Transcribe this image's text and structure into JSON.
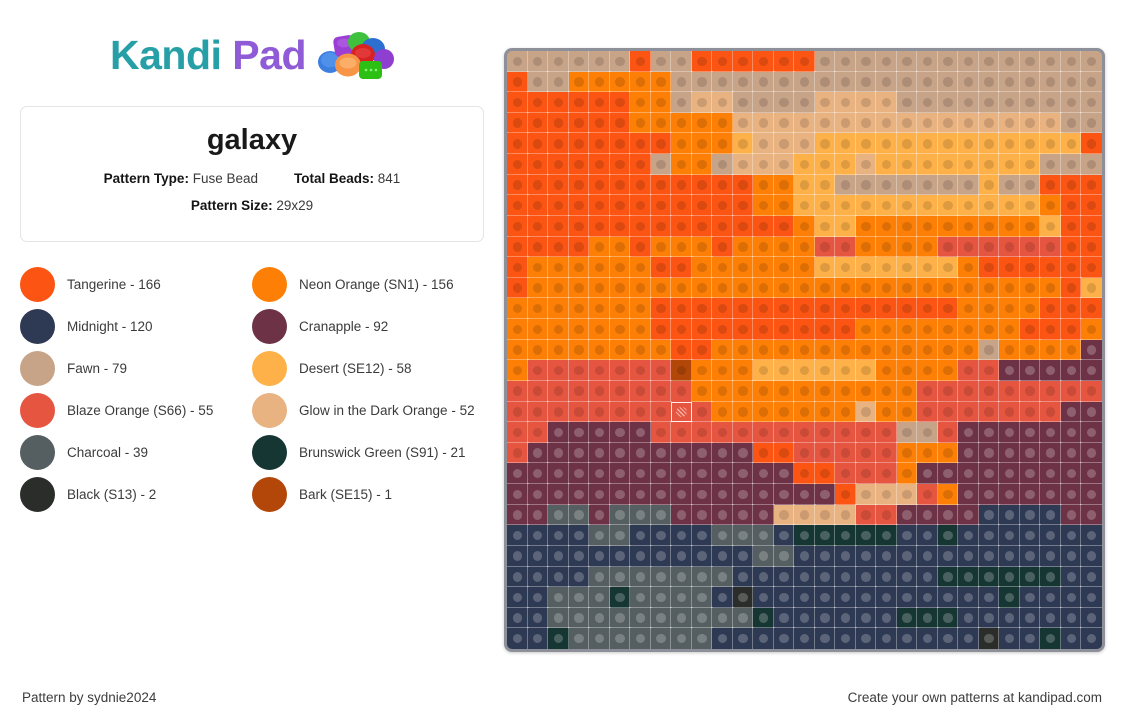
{
  "brand": {
    "name_part1": "Kandi",
    "name_part2": "Pad",
    "logo_icon": "kandi-beads-cluster-icon",
    "color_teal": "#26a0a6",
    "color_purple": "#8f5bd6"
  },
  "info": {
    "title": "galaxy",
    "pattern_type_label": "Pattern Type:",
    "pattern_type_value": "Fuse Bead",
    "total_beads_label": "Total Beads:",
    "total_beads_value": "841",
    "pattern_size_label": "Pattern Size:",
    "pattern_size_value": "29x29"
  },
  "legend": [
    {
      "name": "Tangerine",
      "count": 166,
      "label": "Tangerine - 166",
      "color": "#fb5413"
    },
    {
      "name": "Neon Orange (SN1)",
      "count": 156,
      "label": "Neon Orange (SN1) - 156",
      "color": "#fd7f06"
    },
    {
      "name": "Midnight",
      "count": 120,
      "label": "Midnight - 120",
      "color": "#2e3953"
    },
    {
      "name": "Cranapple",
      "count": 92,
      "label": "Cranapple - 92",
      "color": "#6e3247"
    },
    {
      "name": "Fawn",
      "count": 79,
      "label": "Fawn - 79",
      "color": "#c7a387"
    },
    {
      "name": "Desert (SE12)",
      "count": 58,
      "label": "Desert (SE12) - 58",
      "color": "#feb149"
    },
    {
      "name": "Blaze Orange (S66)",
      "count": 55,
      "label": "Blaze Orange (S66) - 55",
      "color": "#e65540"
    },
    {
      "name": "Glow in the Dark Orange",
      "count": 52,
      "label": "Glow in the Dark Orange - 52",
      "color": "#e9b281"
    },
    {
      "name": "Charcoal",
      "count": 39,
      "label": "Charcoal - 39",
      "color": "#555e60"
    },
    {
      "name": "Brunswick Green (S91)",
      "count": 21,
      "label": "Brunswick Green (S91) - 21",
      "color": "#163634"
    },
    {
      "name": "Black (S13)",
      "count": 2,
      "label": "Black (S13) - 2",
      "color": "#2b2d2b"
    },
    {
      "name": "Bark (SE15)",
      "count": 1,
      "label": "Bark (SE15) - 1",
      "color": "#b24709"
    }
  ],
  "pattern": {
    "width": 29,
    "height": 29,
    "selected_cell": {
      "row": 17,
      "col": 8
    },
    "palette": {
      "T": "#fb5413",
      "N": "#fd7f06",
      "M": "#2e3953",
      "C": "#6e3247",
      "F": "#c7a387",
      "D": "#feb149",
      "B": "#e65540",
      "G": "#e9b281",
      "H": "#555e60",
      "W": "#163634",
      "K": "#2b2d2b",
      "R": "#b24709"
    },
    "rows": [
      "FFFFFFTFFTTTTTTFFFFFFFFFFFFFF",
      "TFFNNNNNFFFFFFFFFFFFFFFFFFFFF",
      "TTTTTTNNFGGFFFFGGGGFFFFFFFFFF",
      "TTTTTTNNNNNGGGGGGGGGGGGGGGGFF",
      "TTTTTTTTNNNDGGGDDDDDDDDDDDDDT",
      "TTTTTTTFNNFGGGDDDGDDDDDDDDFFF",
      "TTTTTTTTTTTTNNDDFFFFFFFDFFTTT",
      "TTTTTTTTTTTTNNDDDDDDDDDDDDNTT",
      "TTTTTTTTTTTTTTNDDNNNNNNNNNDTT",
      "TTTTNNTNNNTNNNNBBNNNNBBBBBBTT",
      "TNNNNNNTTNNNNNNDDDDDDDNTTTTTT",
      "TNNNNNNNNNNNNNNNNNNNNNNNNNNTD",
      "NNNNNNNTTTTTTTTTTTTTTTNNNNTTT",
      "NNNNNNNTTTTTTTTTTNNNNNNNNTTTN",
      "NNNNNNNNTTNNNNNNNNNNNNNFNNNNC",
      "NBBBBBBBRNNNDDDDDDNNNNBBCCCCC",
      "BBBBBBBBBNNNNNNNNNNNBBBBBBBBB",
      "BBBBBBBBBBNNNNNNNGNNBBBBBBBCC",
      "BBCCCCCBBBBBBBBBBBBFFBCCCCCCC",
      "BCCCCCCCCCCCTTBBBBBNNNCCCCCCC",
      "CCCCCCCCCCCCCCTTBBBNCCCCCCCCC",
      "CCCCCCCCCCCCCCCCTGGGBNCCCCCCC",
      "CCHHCHHHCCCCCGGGGBBCCCCMMMMCC",
      "MMMMHHMMMMHHHMWWWWWMMWMMMMMMM",
      "MMMMMMMMMMMMHHMMMMMMMMMMMMMMM",
      "MMMMHHHHHHHMMMMMMMMMMWWWWWWMM",
      "MMHHHWHHHHMKMMMMMMMMMMMMWMMMM",
      "MMHHHHHHHHHHWMMMMMMWWWMMMMMMM",
      "MMWHHHHHHHMMMMMMMMMMMMMKMMWMM"
    ]
  },
  "footer": {
    "left": "Pattern by sydnie2024",
    "right": "Create your own patterns at kandipad.com"
  }
}
